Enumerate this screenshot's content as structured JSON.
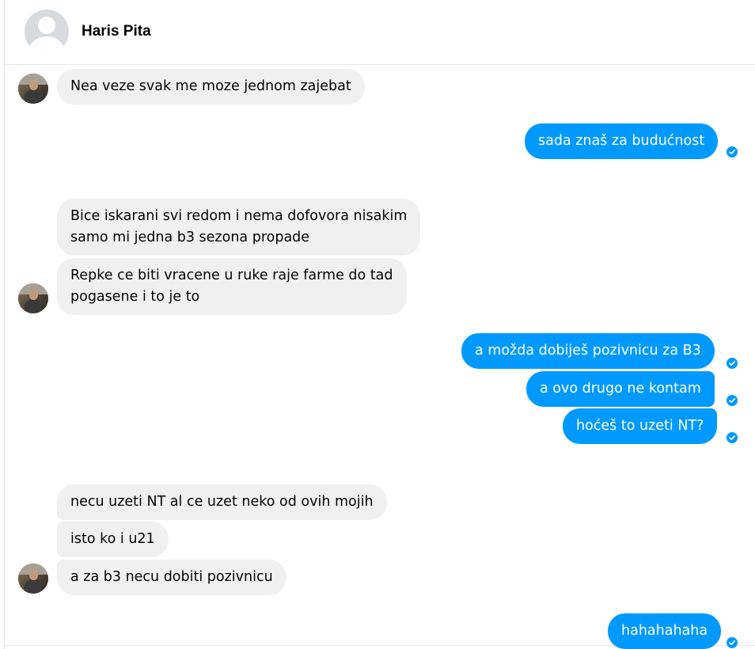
{
  "header": {
    "contact_name": "Haris Pita"
  },
  "messages": [
    {
      "side": "in",
      "text": "Nea veze svak me moze jednom zajebat"
    },
    {
      "side": "out",
      "text": "sada znaš za budućnost",
      "seen": true
    },
    {
      "side": "in",
      "lines": [
        "Bice iskarani svi redom i nema dofovora nisakim",
        "samo mi jedna b3 sezona propade"
      ]
    },
    {
      "side": "in",
      "lines": [
        "Repke ce biti vracene u ruke raje farme do tad",
        "pogasene i to je to"
      ]
    },
    {
      "side": "out",
      "text": "a možda dobiješ pozivnicu za B3",
      "seen": true
    },
    {
      "side": "out",
      "text": "a ovo drugo ne kontam",
      "seen": true
    },
    {
      "side": "out",
      "text": "hoćeš to uzeti NT?",
      "seen": true
    },
    {
      "side": "in",
      "text": "necu uzeti NT al ce uzet neko od ovih mojih"
    },
    {
      "side": "in",
      "text": "isto ko i u21"
    },
    {
      "side": "in",
      "text": "a za b3 necu dobiti pozivnicu"
    },
    {
      "side": "out",
      "text": "hahahahaha",
      "seen": true
    }
  ],
  "icons": {
    "contact_avatar": "default-profile-icon",
    "sender_avatar": "profile-photo",
    "seen_indicator": "check-circle-icon"
  },
  "colors": {
    "outgoing_bubble": "#0099ff",
    "incoming_bubble": "#f0f0f0",
    "text_dark": "#050505"
  }
}
